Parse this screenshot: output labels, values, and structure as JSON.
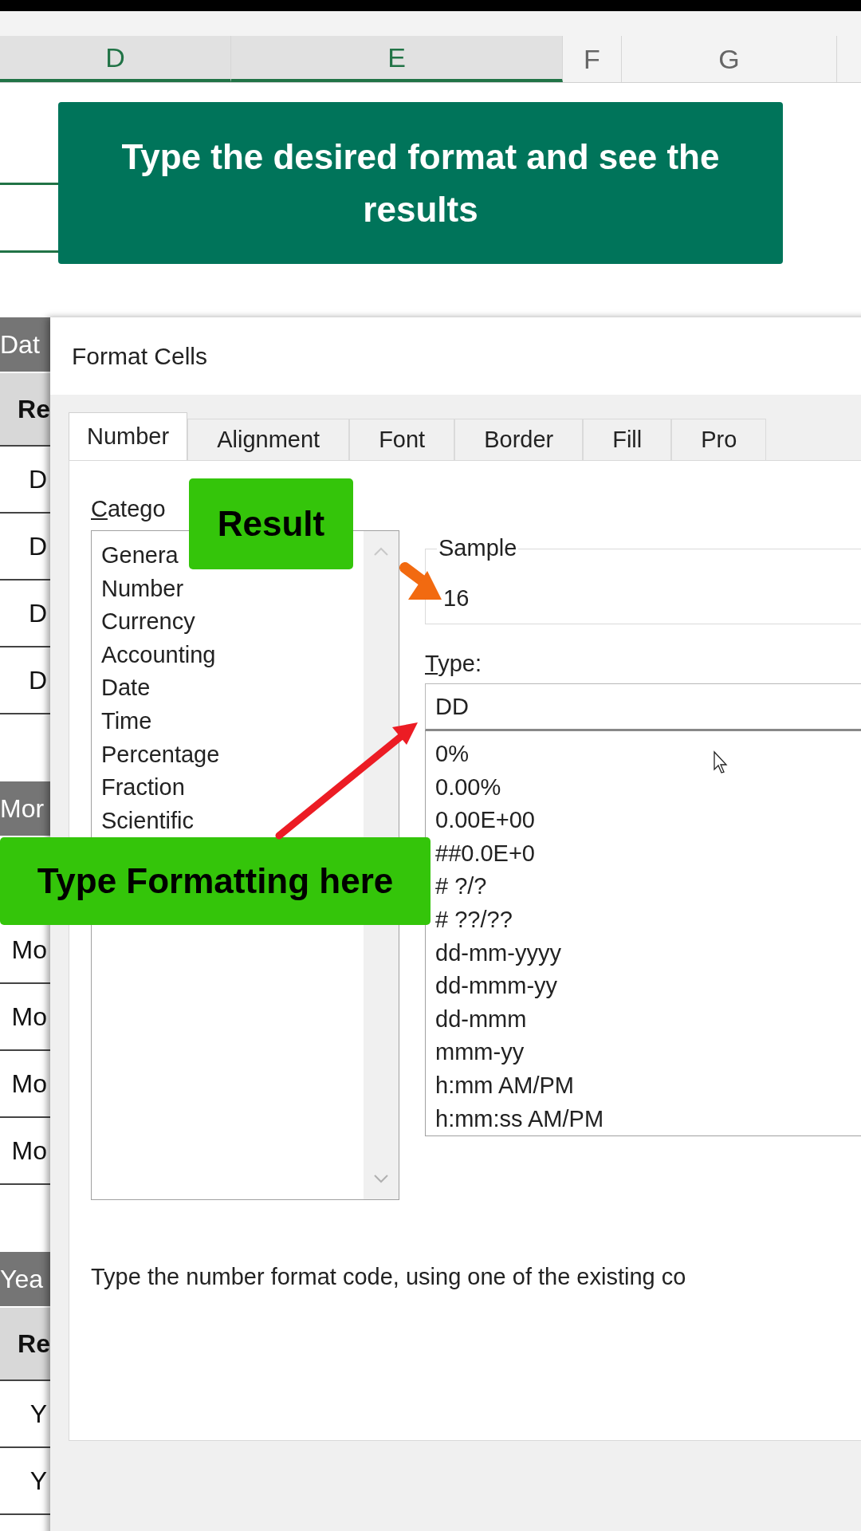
{
  "spreadsheet": {
    "column_headers": [
      {
        "label": "D",
        "selected": true
      },
      {
        "label": "E",
        "selected": true
      },
      {
        "label": "F",
        "selected": false
      },
      {
        "label": "G",
        "selected": false
      }
    ],
    "row_cells": [
      {
        "kind": "header",
        "text": "Dat"
      },
      {
        "kind": "subheader",
        "text": "Re"
      },
      {
        "kind": "cell",
        "text": "D"
      },
      {
        "kind": "cell",
        "text": "D"
      },
      {
        "kind": "cell",
        "text": "D"
      },
      {
        "kind": "cell",
        "text": "D"
      },
      {
        "kind": "gap"
      },
      {
        "kind": "header",
        "text": "Mor"
      },
      {
        "kind": "blank"
      },
      {
        "kind": "cell",
        "text": "Mo"
      },
      {
        "kind": "cell",
        "text": "Mo"
      },
      {
        "kind": "cell",
        "text": "Mo"
      },
      {
        "kind": "cell",
        "text": "Mo"
      },
      {
        "kind": "gap"
      },
      {
        "kind": "header",
        "text": "Yea"
      },
      {
        "kind": "subheader",
        "text": "Re"
      },
      {
        "kind": "cell",
        "text": "Y"
      },
      {
        "kind": "cell",
        "text": "Y"
      }
    ]
  },
  "banner": {
    "text": "Type the desired format and see the results"
  },
  "dialog": {
    "title": "Format Cells",
    "tabs": [
      {
        "label": "Number",
        "selected": true
      },
      {
        "label": "Alignment",
        "selected": false
      },
      {
        "label": "Font",
        "selected": false
      },
      {
        "label": "Border",
        "selected": false
      },
      {
        "label": "Fill",
        "selected": false
      },
      {
        "label": "Pro",
        "selected": false
      }
    ],
    "category": {
      "label": "Catego",
      "items": [
        "Genera",
        "Number",
        "Currency",
        "Accounting",
        "Date",
        "Time",
        "Percentage",
        "Fraction",
        "Scientific"
      ]
    },
    "sample": {
      "label": "Sample",
      "value": "16"
    },
    "type": {
      "label": "Type:",
      "value": "DD"
    },
    "formats": [
      "0%",
      "0.00%",
      "0.00E+00",
      "##0.0E+0",
      "# ?/?",
      "# ??/??",
      "dd-mm-yyyy",
      "dd-mmm-yy",
      "dd-mmm",
      "mmm-yy",
      "h:mm AM/PM",
      "h:mm:ss AM/PM"
    ],
    "description": "Type the number format code, using one of the existing co"
  },
  "callouts": [
    {
      "text": "Result"
    },
    {
      "text": "Type Formatting here"
    }
  ]
}
